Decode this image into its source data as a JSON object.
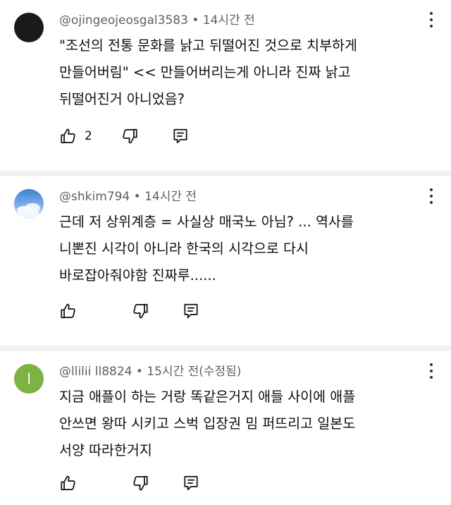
{
  "comments": [
    {
      "avatar_letter": "",
      "username": "@ojingeojeosgal3583",
      "separator": "•",
      "time": "14시간 전",
      "lines": [
        "\"조선의 전통 문화를 낡고 뒤떨어진 것으로 치부하게",
        "만들어버림\" << 만들어버리는게 아니라 진짜 낡고",
        "뒤떨어진거 아니었음?"
      ],
      "likes": "2"
    },
    {
      "avatar_letter": "",
      "username": "@shkim794",
      "separator": "•",
      "time": "14시간 전",
      "lines": [
        "근데 저 상위계층 =  사실상 매국노  아님? ... 역사를",
        "니뽄진 시각이 아니라  한국의 시각으로 다시",
        "바로잡아줘야함 진짜루......"
      ],
      "likes": ""
    },
    {
      "avatar_letter": "l",
      "username": "@llilii ll8824",
      "separator": "•",
      "time": "15시간 전(수정됨)",
      "lines": [
        "지금 애플이 하는 거랑 똑같은거지 애들 사이에 애플",
        "안쓰면 왕따 시키고 스벅 입장권 밈 퍼뜨리고 일본도",
        "서양 따라한거지"
      ],
      "likes": ""
    }
  ],
  "icons": {
    "like": "thumb-up-icon",
    "dislike": "thumb-down-icon",
    "reply": "reply-icon",
    "more": "more-vert-icon"
  },
  "colors": {
    "text": "#0f0f0f",
    "secondary": "#606060",
    "divider": "#f2f2f2",
    "avatar_green": "#7cb342"
  }
}
